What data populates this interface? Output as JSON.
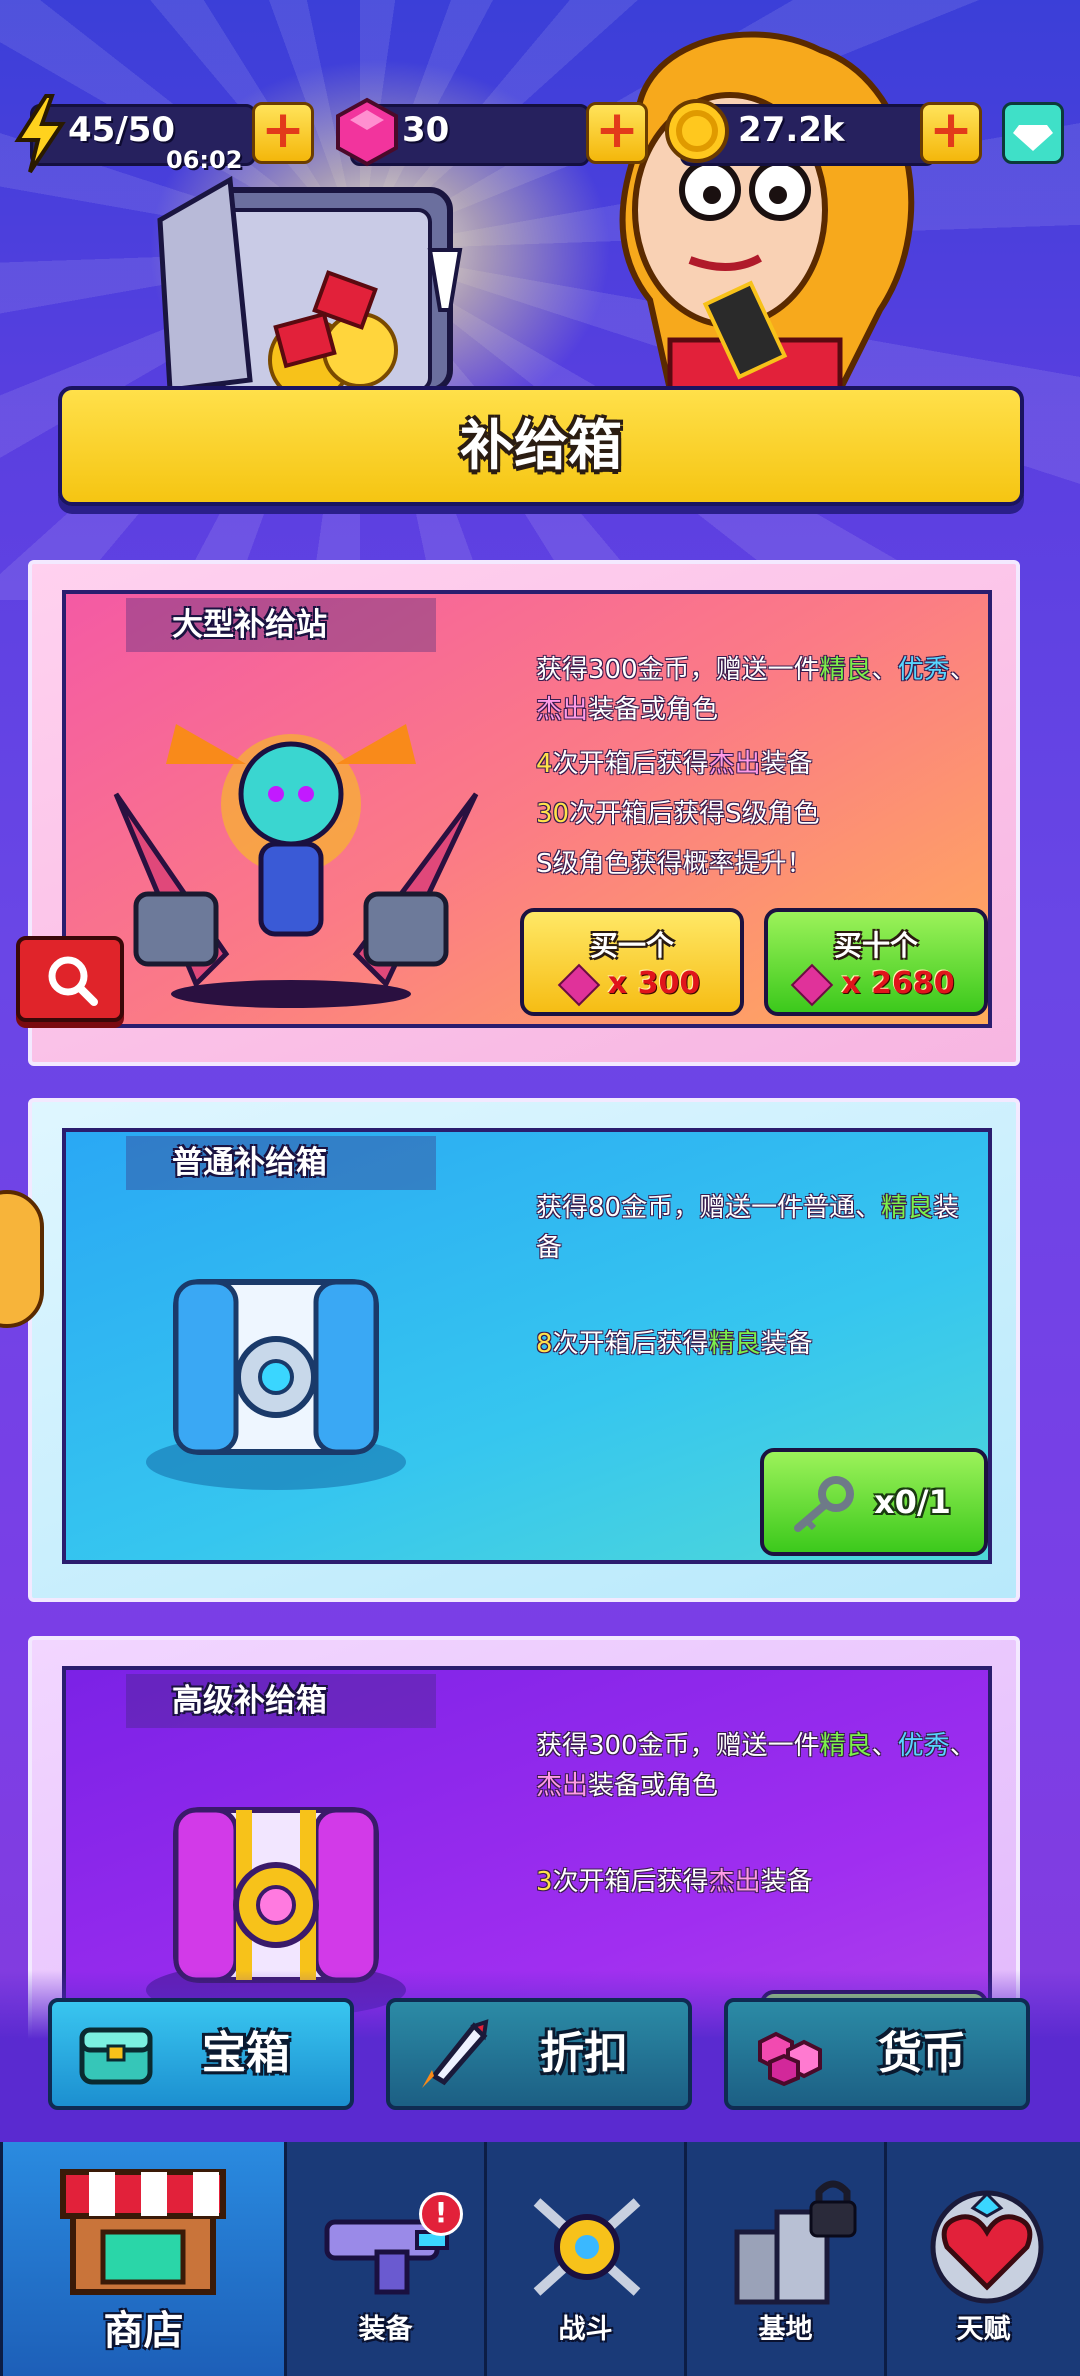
{
  "resources": {
    "energy": {
      "value": "45/50",
      "timer": "06:02"
    },
    "gems": {
      "value": "30"
    },
    "coins": {
      "value": "27.2k"
    },
    "plus_label": "+"
  },
  "header": {
    "title": "补给箱"
  },
  "colors": {
    "accent_yellow": "#f5c512",
    "good_green": "#7cf04a",
    "rare_blue": "#57d6ff",
    "epic_pink": "#ff9ae5"
  },
  "cards": [
    {
      "title": "大型补给站",
      "desc": {
        "line1_a": "获得300金币，赠送一件",
        "line1_b": "精良",
        "line1_c": "、",
        "line1_d": "优秀",
        "line1_e": "、",
        "line2_a": "杰出",
        "line2_b": "装备或角色",
        "line3_a": "4",
        "line3_b": "次开箱后获得",
        "line3_c": "杰出",
        "line3_d": "装备",
        "line4_a": "30",
        "line4_b": "次开箱后获得S级角色",
        "line5": "S级角色获得概率提升！"
      },
      "buy_one": {
        "label": "买一个",
        "price": "x 300"
      },
      "buy_ten": {
        "label": "买十个",
        "price": "x 2680"
      }
    },
    {
      "title": "普通补给箱",
      "desc": {
        "line1_a": "获得80金币，赠送一件普通、",
        "line1_b": "精良",
        "line1_c": "装",
        "line2": "备",
        "line3_a": "8",
        "line3_b": "次开箱后获得",
        "line3_c": "精良",
        "line3_d": "装备"
      },
      "key_button": {
        "label": "x0/1"
      }
    },
    {
      "title": "高级补给箱",
      "desc": {
        "line1_a": "获得300金币，赠送一件",
        "line1_b": "精良",
        "line1_c": "、",
        "line1_d": "优秀",
        "line1_e": "、",
        "line2_a": "杰出",
        "line2_b": "装备或角色",
        "line3_a": "3",
        "line3_b": "次开箱后获得",
        "line3_c": "杰出",
        "line3_d": "装备"
      }
    }
  ],
  "category_tabs": [
    {
      "label": "宝箱",
      "icon": "chest-icon",
      "active": true
    },
    {
      "label": "折扣",
      "icon": "rocket-icon",
      "active": false
    },
    {
      "label": "货币",
      "icon": "gems-icon",
      "active": false
    }
  ],
  "bottom_nav": [
    {
      "label": "商店",
      "icon": "shop-icon",
      "active": true
    },
    {
      "label": "装备",
      "icon": "gun-icon",
      "badge": "!"
    },
    {
      "label": "战斗",
      "icon": "battle-icon"
    },
    {
      "label": "基地",
      "icon": "base-icon",
      "locked": true
    },
    {
      "label": "天赋",
      "icon": "talent-heart-icon"
    }
  ]
}
